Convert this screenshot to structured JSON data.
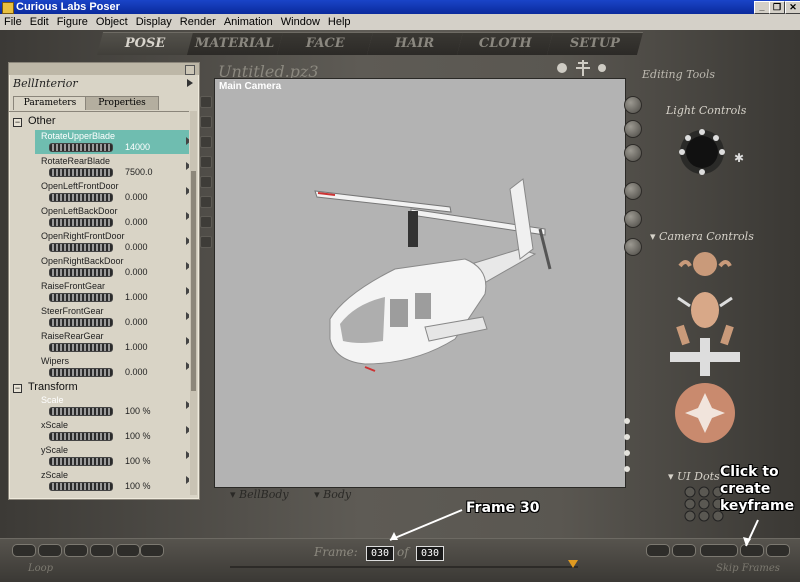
{
  "window": {
    "title": "Curious Labs Poser",
    "controls": [
      "_",
      "❐",
      "✕"
    ]
  },
  "menu": [
    "File",
    "Edit",
    "Figure",
    "Object",
    "Display",
    "Render",
    "Animation",
    "Window",
    "Help"
  ],
  "tabs": [
    "POSE",
    "MATERIAL",
    "FACE",
    "HAIR",
    "CLOTH",
    "SETUP"
  ],
  "params_panel": {
    "title": "BellInterior",
    "tabs": [
      "Parameters",
      "Properties"
    ],
    "groups": [
      {
        "name": "Other",
        "items": [
          {
            "label": "RotateUpperBlade",
            "value": "14000",
            "selected": true
          },
          {
            "label": "RotateRearBlade",
            "value": "7500.0"
          },
          {
            "label": "OpenLeftFrontDoor",
            "value": "0.000"
          },
          {
            "label": "OpenLeftBackDoor",
            "value": "0.000"
          },
          {
            "label": "OpenRightFrontDoor",
            "value": "0.000"
          },
          {
            "label": "OpenRightBackDoor",
            "value": "0.000"
          },
          {
            "label": "RaiseFrontGear",
            "value": "1.000"
          },
          {
            "label": "SteerFrontGear",
            "value": "0.000"
          },
          {
            "label": "RaiseRearGear",
            "value": "1.000"
          },
          {
            "label": "Wipers",
            "value": "0.000"
          }
        ]
      },
      {
        "name": "Transform",
        "items": [
          {
            "label": "Scale",
            "value": "100 %",
            "highlight": true
          },
          {
            "label": "xScale",
            "value": "100 %"
          },
          {
            "label": "yScale",
            "value": "100 %"
          },
          {
            "label": "zScale",
            "value": "100 %"
          }
        ]
      }
    ]
  },
  "document": {
    "name": "Untitled.pz3",
    "camera": "Main Camera"
  },
  "below_view": {
    "figure": "BellBody",
    "part": "Body"
  },
  "right_panel": {
    "editing_tools": "Editing Tools",
    "light_controls": "Light Controls",
    "camera_controls": "Camera Controls",
    "ui_dots": "UI Dots"
  },
  "timeline": {
    "frame_label": "Frame:",
    "current": "030",
    "of_label": "of",
    "total": "030",
    "loop": "Loop",
    "skip_frames": "Skip Frames"
  },
  "annotations": {
    "frame": "Frame 30",
    "keyframe": "Click to create keyframe"
  },
  "colors": {
    "selection": "#6fbdb0",
    "scrub_marker": "#e09a20"
  }
}
